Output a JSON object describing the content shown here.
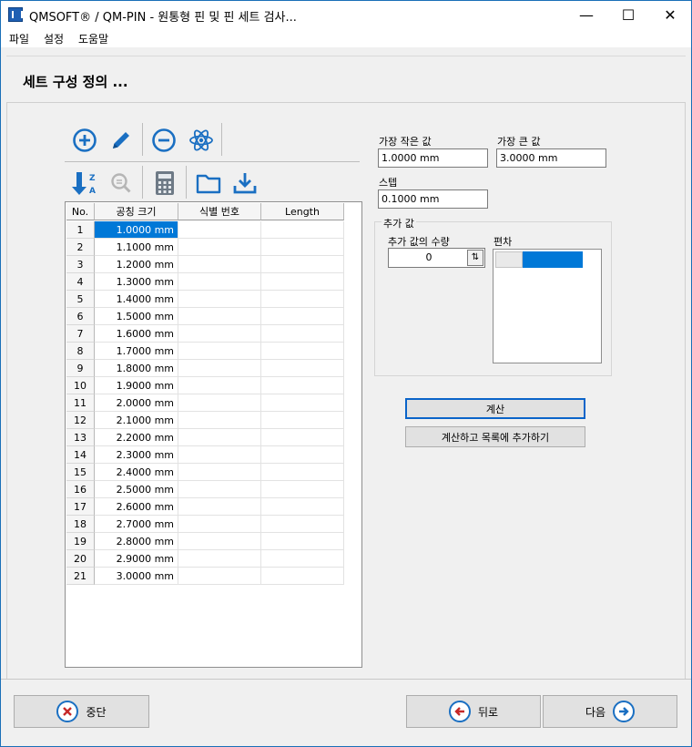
{
  "window": {
    "title": "QMSOFT® / QM-PIN - 원통형 핀 및 핀 세트 검사...",
    "minimize": "—",
    "maximize": "☐",
    "close": "✕"
  },
  "menu": [
    "파일",
    "설정",
    "도움말"
  ],
  "page_title": "세트 구성 정의 ...",
  "toolbar": {
    "row1": [
      "add-circle-icon",
      "pencil-icon",
      "remove-circle-icon",
      "atom-icon"
    ],
    "row2": [
      "sort-z-a-icon",
      "magnifier-icon",
      "calculator-icon",
      "folder-icon",
      "download-icon"
    ]
  },
  "grid": {
    "headers": [
      "No.",
      "공칭 크기",
      "식별 번호",
      "Length"
    ],
    "rows": [
      {
        "no": "1",
        "size": "1.0000 mm"
      },
      {
        "no": "2",
        "size": "1.1000 mm"
      },
      {
        "no": "3",
        "size": "1.2000 mm"
      },
      {
        "no": "4",
        "size": "1.3000 mm"
      },
      {
        "no": "5",
        "size": "1.4000 mm"
      },
      {
        "no": "6",
        "size": "1.5000 mm"
      },
      {
        "no": "7",
        "size": "1.6000 mm"
      },
      {
        "no": "8",
        "size": "1.7000 mm"
      },
      {
        "no": "9",
        "size": "1.8000 mm"
      },
      {
        "no": "10",
        "size": "1.9000 mm"
      },
      {
        "no": "11",
        "size": "2.0000 mm"
      },
      {
        "no": "12",
        "size": "2.1000 mm"
      },
      {
        "no": "13",
        "size": "2.2000 mm"
      },
      {
        "no": "14",
        "size": "2.3000 mm"
      },
      {
        "no": "15",
        "size": "2.4000 mm"
      },
      {
        "no": "16",
        "size": "2.5000 mm"
      },
      {
        "no": "17",
        "size": "2.6000 mm"
      },
      {
        "no": "18",
        "size": "2.7000 mm"
      },
      {
        "no": "19",
        "size": "2.8000 mm"
      },
      {
        "no": "20",
        "size": "2.9000 mm"
      },
      {
        "no": "21",
        "size": "3.0000 mm"
      }
    ]
  },
  "form": {
    "min_label": "가장 작은 값",
    "min_value": "1.0000 mm",
    "max_label": "가장 큰 값",
    "max_value": "3.0000 mm",
    "step_label": "스텝",
    "step_value": "0.1000 mm",
    "group_title": "추가 값",
    "count_label": "추가 값의 수량",
    "count_value": "0",
    "deviation_label": "편차"
  },
  "buttons": {
    "calculate": "계산",
    "calc_add": "계산하고 목록에 추가하기",
    "cancel": "중단",
    "back": "뒤로",
    "next": "다음"
  },
  "colors": {
    "accent": "#0078d7",
    "icon_blue": "#1a6fc2",
    "cancel_red": "#c62828"
  }
}
